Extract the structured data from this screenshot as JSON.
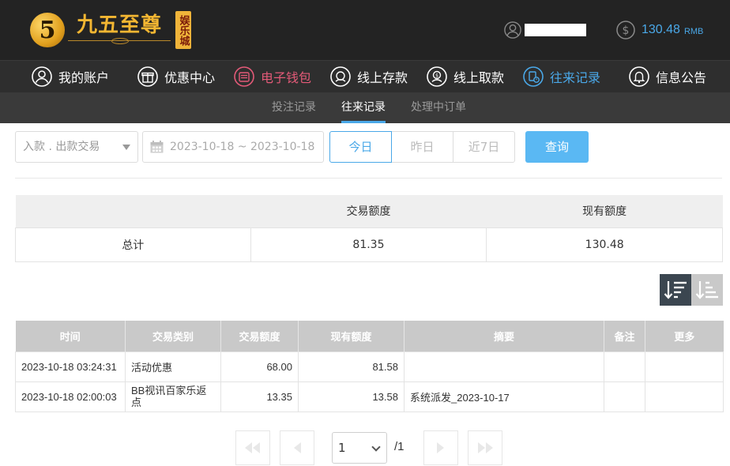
{
  "header": {
    "logo_text": "九五至尊",
    "logo_badge": "娱乐城",
    "logo_numeral": "5",
    "balance": "130.48",
    "balance_unit": "RMB"
  },
  "main_nav": [
    {
      "label": "我的账户",
      "icon": "user-icon"
    },
    {
      "label": "优惠中心",
      "icon": "gift-icon"
    },
    {
      "label": "电子钱包",
      "icon": "wallet-icon"
    },
    {
      "label": "线上存款",
      "icon": "deposit-icon"
    },
    {
      "label": "线上取款",
      "icon": "withdraw-icon"
    },
    {
      "label": "往来记录",
      "icon": "record-icon"
    },
    {
      "label": "信息公告",
      "icon": "bell-icon"
    }
  ],
  "sub_nav": [
    {
      "label": "投注记录"
    },
    {
      "label": "往来记录"
    },
    {
      "label": "处理中订单"
    }
  ],
  "filters": {
    "type_selected": "入款 . 出款交易",
    "date_range": "2023-10-18 ~ 2023-10-18",
    "ranges": [
      "今日",
      "昨日",
      "近7日"
    ],
    "query_label": "查询"
  },
  "summary": {
    "headers": [
      "",
      "交易额度",
      "现有额度"
    ],
    "row": [
      "总计",
      "81.35",
      "130.48"
    ]
  },
  "records": {
    "headers": [
      "时间",
      "交易类别",
      "交易额度",
      "现有额度",
      "摘要",
      "备注",
      "更多"
    ],
    "rows": [
      [
        "2023-10-18 03:24:31",
        "活动优惠",
        "68.00",
        "81.58",
        "",
        "",
        ""
      ],
      [
        "2023-10-18 02:00:03",
        "BB视讯百家乐返点",
        "13.35",
        "13.58",
        "系统派发_2023-10-17",
        "",
        ""
      ]
    ]
  },
  "pagination": {
    "current": "1",
    "total": "/1"
  },
  "colors": {
    "accent": "#4aa8e8",
    "header_bg": "#232323",
    "nav_bg": "#2e2e2e",
    "wallet_red": "#e35a78"
  }
}
